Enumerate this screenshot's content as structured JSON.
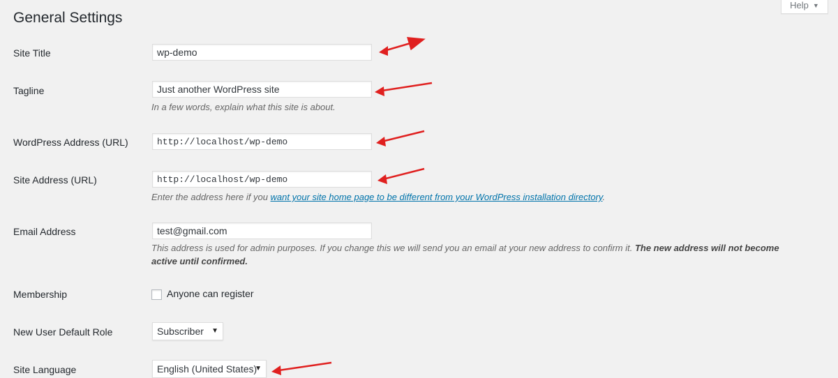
{
  "page": {
    "title": "General Settings"
  },
  "help": {
    "label": "Help"
  },
  "fields": {
    "site_title": {
      "label": "Site Title",
      "value": "wp-demo"
    },
    "tagline": {
      "label": "Tagline",
      "value": "Just another WordPress site",
      "description": "In a few words, explain what this site is about."
    },
    "wp_address": {
      "label": "WordPress Address (URL)",
      "value": "http://localhost/wp-demo"
    },
    "site_address": {
      "label": "Site Address (URL)",
      "value": "http://localhost/wp-demo",
      "description_prefix": "Enter the address here if you ",
      "description_link": "want your site home page to be different from your WordPress installation directory",
      "description_suffix": "."
    },
    "email": {
      "label": "Email Address",
      "value": "test@gmail.com",
      "description_plain": "This address is used for admin purposes. If you change this we will send you an email at your new address to confirm it. ",
      "description_bold": "The new address will not become active until confirmed."
    },
    "membership": {
      "label": "Membership",
      "checkbox_label": "Anyone can register",
      "checked": false
    },
    "default_role": {
      "label": "New User Default Role",
      "value": "Subscriber"
    },
    "site_language": {
      "label": "Site Language",
      "value": "English (United States)"
    }
  },
  "colors": {
    "accent": "#0073aa",
    "annotation_arrow": "#e0201f",
    "background": "#f1f1f1"
  }
}
